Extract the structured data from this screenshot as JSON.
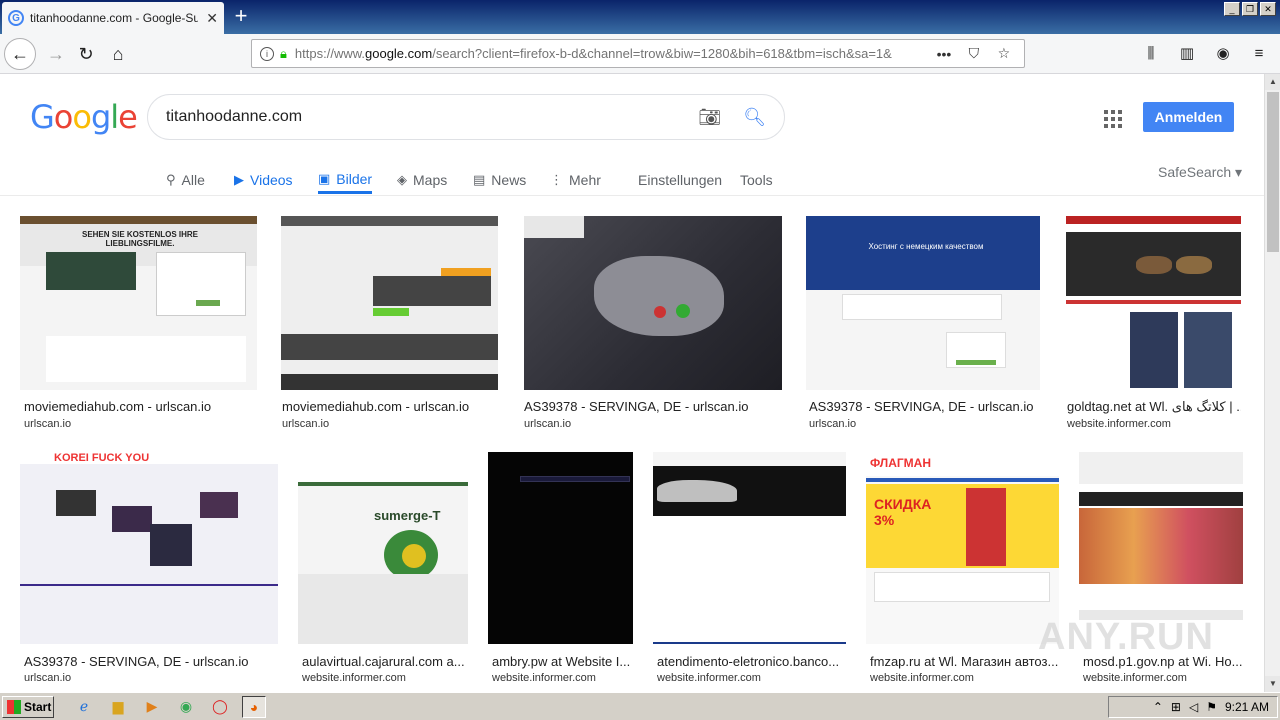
{
  "browser": {
    "tab_title": "titanhoodanne.com - Google-Suche",
    "tab_close": "✕",
    "new_tab": "+",
    "url_prefix": "https://www.",
    "url_domain": "google.com",
    "url_rest": "/search?client=firefox-b-d&channel=trow&biw=1280&bih=618&tbm=isch&sa=1&",
    "page_actions": "•••"
  },
  "google": {
    "logo": [
      "G",
      "o",
      "o",
      "g",
      "l",
      "e"
    ],
    "logo_colors": [
      "#4285f4",
      "#ea4335",
      "#fbbc05",
      "#4285f4",
      "#34a853",
      "#ea4335"
    ],
    "query": "titanhoodanne.com",
    "signin": "Anmelden",
    "safesearch": "SafeSearch ▾",
    "tabs": [
      {
        "label": "Alle",
        "icon": "🔍"
      },
      {
        "label": "Videos",
        "icon": "▶"
      },
      {
        "label": "Bilder",
        "icon": "▣"
      },
      {
        "label": "Maps",
        "icon": "◈"
      },
      {
        "label": "News",
        "icon": "▤"
      },
      {
        "label": "Mehr",
        "icon": "⋮"
      },
      {
        "label": "Einstellungen",
        "icon": ""
      },
      {
        "label": "Tools",
        "icon": ""
      }
    ]
  },
  "results": [
    {
      "title": "moviemediahub.com - urlscan.io",
      "source": "urlscan.io"
    },
    {
      "title": "moviemediahub.com - urlscan.io",
      "source": "urlscan.io"
    },
    {
      "title": "AS39378 - SERVINGA, DE - urlscan.io",
      "source": "urlscan.io"
    },
    {
      "title": "AS39378 - SERVINGA, DE - urlscan.io",
      "source": "urlscan.io"
    },
    {
      "title": "goldtag.net at Wl. کلاتگ های | ...",
      "source": "website.informer.com"
    },
    {
      "title": "AS39378 - SERVINGA, DE - urlscan.io",
      "source": "urlscan.io"
    },
    {
      "title": "aulavirtual.cajarural.com a...",
      "source": "website.informer.com"
    },
    {
      "title": "ambry.pw at Website I...",
      "source": "website.informer.com"
    },
    {
      "title": "atendimento-eletronico.banco...",
      "source": "website.informer.com"
    },
    {
      "title": "fmzap.ru at Wl. Магазин автоз...",
      "source": "website.informer.com"
    },
    {
      "title": "mosd.p1.gov.np at Wi. Ho...",
      "source": "website.informer.com"
    }
  ],
  "thumb_text": {
    "t1_heading": "SEHEN SIE KOSTENLOS IHRE LIEBLINGSFILME.",
    "t4_heading": "Хостинг с немецким качеством",
    "t6_heading": "KOREI FUCK YOU",
    "t7_heading": "sumerge-T",
    "t10_heading": "СКИДКА 3%",
    "t10_brand": "ФЛАГМАН"
  },
  "watermark": "ANY.RUN",
  "taskbar": {
    "start": "Start",
    "clock": "9:21 AM"
  }
}
